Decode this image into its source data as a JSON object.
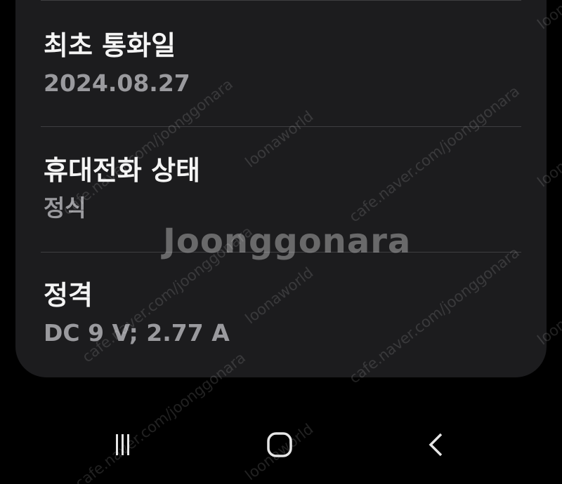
{
  "info_items": [
    {
      "title": "최초 통화일",
      "value": "2024.08.27"
    },
    {
      "title": "휴대전화 상태",
      "value": "정식"
    },
    {
      "title": "정격",
      "value": "DC 9 V; 2.77 A"
    }
  ],
  "watermark": {
    "logo": "Joonggonara",
    "url_text": "cafe.naver.com/joonggonara",
    "small_text": "loonaworld"
  },
  "navigation": {
    "recents": "recents-icon",
    "home": "home-icon",
    "back": "back-icon"
  },
  "colors": {
    "background": "#000000",
    "card": "#1c1c1e",
    "title_text": "#f4f4f4",
    "value_text": "#9a9a9e",
    "divider": "#3e3e41"
  }
}
